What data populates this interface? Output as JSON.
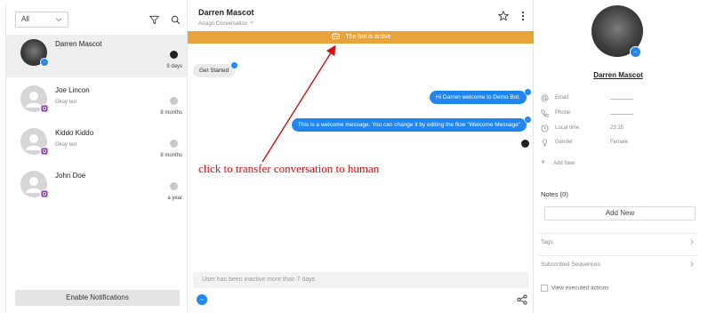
{
  "colors": {
    "accent": "#1f86ef",
    "bot_bar": "#e8a33c",
    "annotation": "#cc1010"
  },
  "sidebar": {
    "filter_value": "All",
    "conversations": [
      {
        "name": "Darren Mascot",
        "preview": "",
        "time": "9 days",
        "channel": "messenger",
        "status": "dark",
        "avatar": "photo"
      },
      {
        "name": "Joe Lincon",
        "preview": "Okay ted",
        "time": "8 months",
        "channel": "instagram",
        "status": "grey",
        "avatar": "placeholder"
      },
      {
        "name": "Kiddo Kiddo",
        "preview": "Okay ted",
        "time": "8 months",
        "channel": "instagram",
        "status": "grey",
        "avatar": "placeholder"
      },
      {
        "name": "John Doe",
        "preview": "",
        "time": "a year",
        "channel": "instagram",
        "status": "grey",
        "avatar": "placeholder"
      }
    ],
    "enable_notifications": "Enable Notifications"
  },
  "chat": {
    "contact_name": "Darren Mascot",
    "assign_label": "Assign Conversation",
    "bot_status": "The bot is active",
    "messages": [
      {
        "direction": "in",
        "text": "Get Started"
      },
      {
        "direction": "out",
        "text": "Hi Darren welcome to Demo Bot."
      },
      {
        "direction": "out",
        "text": "This is a welcome message. You can change it by editing the flow \"Welcome Message\""
      }
    ],
    "annotation": "click to transfer conversation to human",
    "composer_placeholder": "User has been inactive more than 7 days"
  },
  "profile": {
    "name": "Darren Mascot",
    "fields": [
      {
        "icon": "at-icon",
        "label": "Email",
        "value": ""
      },
      {
        "icon": "phone-icon",
        "label": "Phone",
        "value": ""
      },
      {
        "icon": "clock-icon",
        "label": "Local time",
        "value": "23:15"
      },
      {
        "icon": "gender-icon",
        "label": "Gender",
        "value": "Female"
      }
    ],
    "add_new_field": "Add New",
    "notes_title": "Notes (0)",
    "notes_add": "Add New",
    "tags_label": "Tags",
    "sequences_label": "Subscribed Sequences",
    "view_actions_label": "View executed actions"
  }
}
